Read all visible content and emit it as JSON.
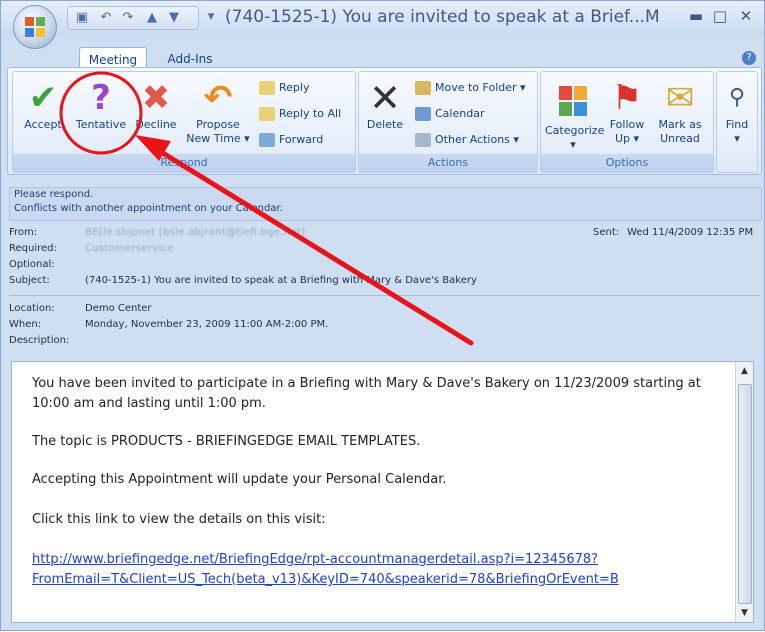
{
  "window": {
    "title": "(740-1525-1) You are invited to speak at a Brief...M",
    "minimize_glyph": "▬",
    "restore_glyph": "□",
    "close_glyph": "✕"
  },
  "tabs": [
    "Meeting",
    "Add-Ins"
  ],
  "ribbon": {
    "respond": {
      "label": "Respond",
      "accept": "Accept",
      "tentative": "Tentative",
      "decline": "Decline",
      "propose_line1": "Propose",
      "propose_line2": "New Time ▾",
      "reply": "Reply",
      "reply_all": "Reply to All",
      "forward": "Forward"
    },
    "actions": {
      "label": "Actions",
      "delete": "Delete",
      "move_to_folder": "Move to Folder ▾",
      "calendar": "Calendar",
      "other_actions": "Other Actions ▾"
    },
    "options": {
      "label": "Options",
      "categorize_line1": "Categorize",
      "categorize_line2": "▾",
      "follow_line1": "Follow",
      "follow_line2": "Up ▾",
      "mark_line1": "Mark as",
      "mark_line2": "Unread"
    },
    "find": {
      "label_line1": "Find",
      "label_line2": "▾"
    }
  },
  "infobar": {
    "line1": "Please respond.",
    "line2": "Conflicts with another appointment on your Calendar."
  },
  "header": {
    "from_label": "From:",
    "from_value": "BE[Ie.sbjpnet [bsle.objrant@tiefl.bge.net]",
    "sent_label": "Sent:",
    "sent_value": "Wed 11/4/2009 12:35 PM",
    "required_label": "Required:",
    "required_value": "Customerservice",
    "optional_label": "Optional:",
    "subject_label": "Subject:",
    "subject_value": "(740-1525-1) You are invited to speak at a Briefing with Mary & Dave's Bakery",
    "location_label": "Location:",
    "location_value": "Demo Center",
    "when_label": "When:",
    "when_value": "Monday, November 23, 2009 11:00 AM-2:00 PM.",
    "description_label": "Description:"
  },
  "body": {
    "p1": "You have been invited to participate in a Briefing with Mary & Dave's Bakery on 11/23/2009 starting at 10:00 am and lasting until 1:00 pm.",
    "p2": "The topic is PRODUCTS - BRIEFINGEDGE EMAIL TEMPLATES.",
    "p3": "Accepting this Appointment will update your Personal Calendar.",
    "p4": "Click this link to view the details on this visit:",
    "link_line1": "http://www.briefingedge.net/BriefingEdge/rpt-accountmanagerdetail.asp?i=12345678?",
    "link_line2": "FromEmail=T&Client=US_Tech(beta_v13)&KeyID=740&speakerid=78&BriefingOrEvent=B"
  },
  "colors": {
    "accent": "#15428b",
    "annotation": "#e8141a",
    "link": "#1f3fd1"
  }
}
